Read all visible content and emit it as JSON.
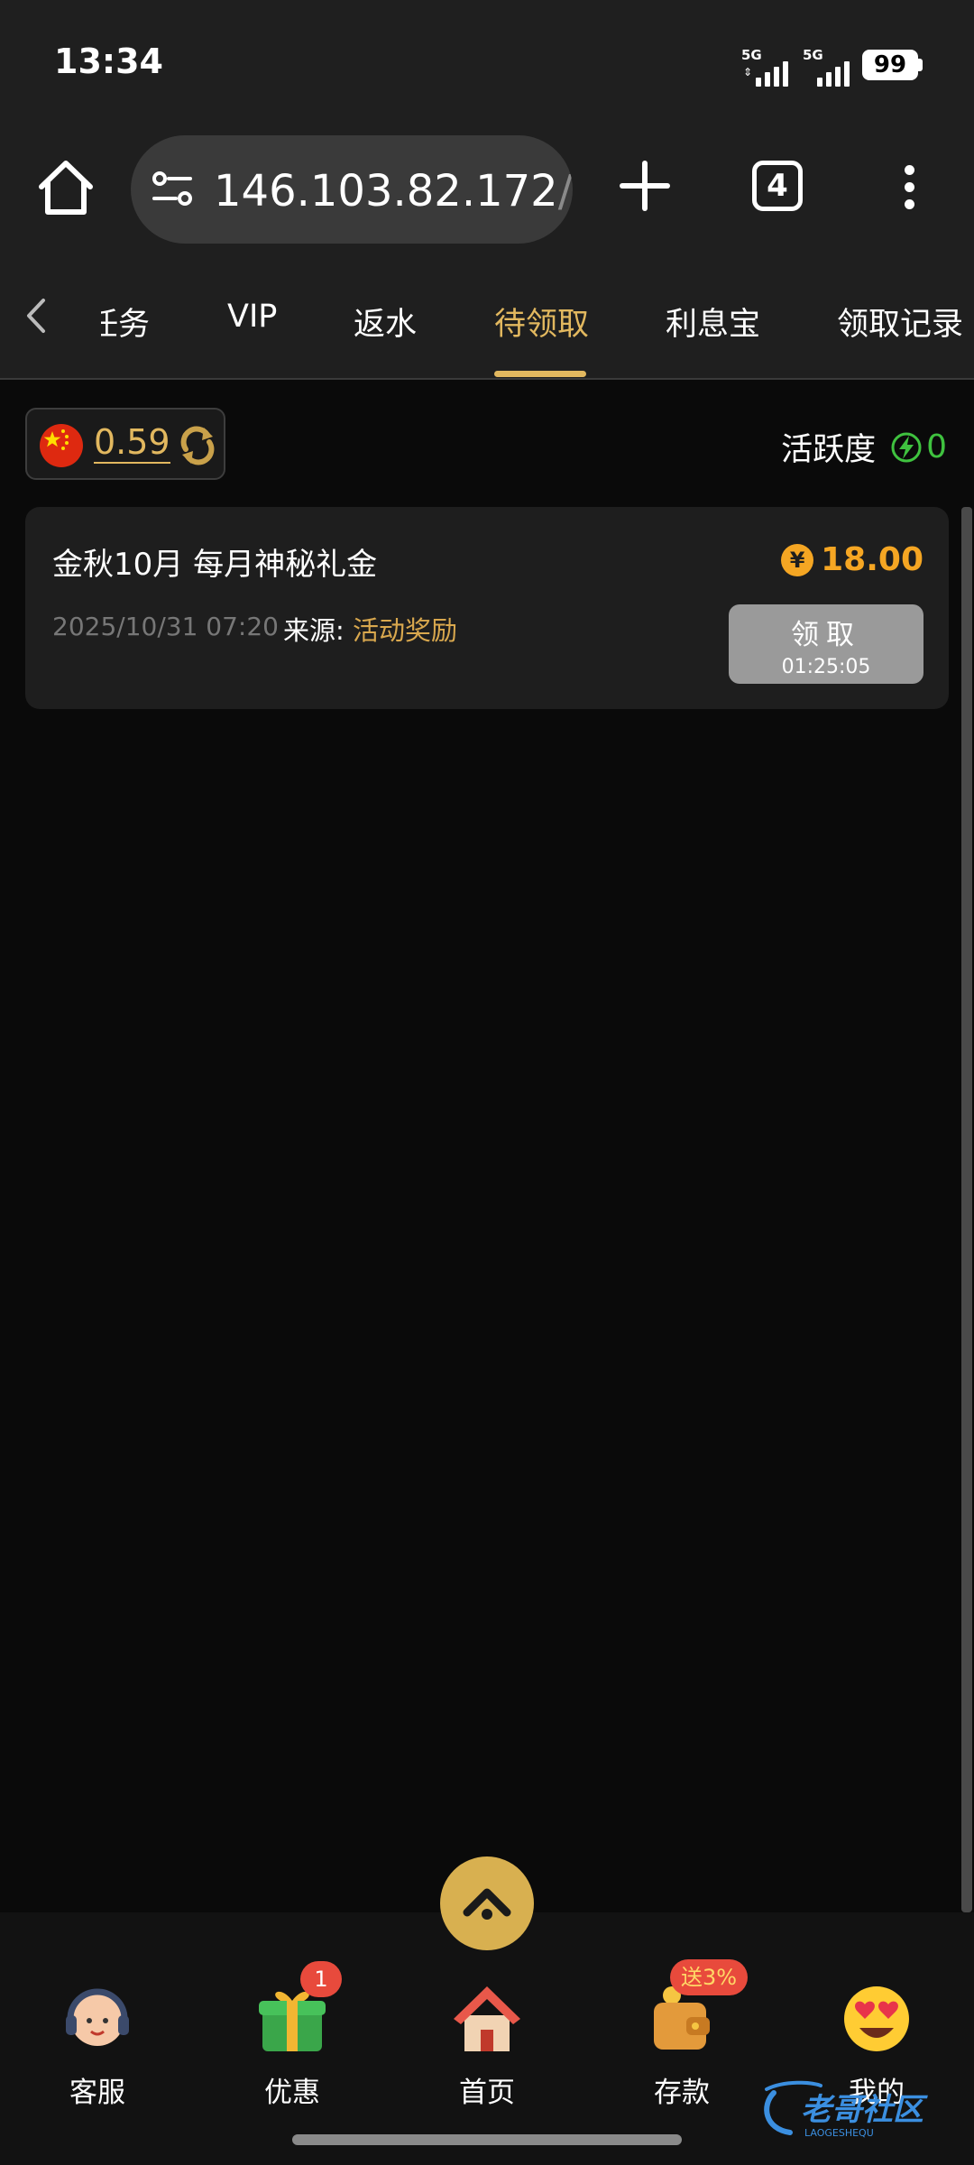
{
  "status_bar": {
    "time": "13:34",
    "signal_1_label": "5G",
    "signal_2_label": "5G",
    "battery": "99"
  },
  "browser": {
    "url_main": "146.103.82.172",
    "url_dim": "/h",
    "tab_count": "4",
    "icons": [
      "home-icon",
      "tune-icon",
      "plus-icon",
      "tabs-icon",
      "more-vert-icon"
    ]
  },
  "tabs": {
    "items": [
      {
        "label": "任务"
      },
      {
        "label": "VIP"
      },
      {
        "label": "返水"
      },
      {
        "label": "待领取"
      },
      {
        "label": "利息宝"
      },
      {
        "label": "领取记录"
      }
    ],
    "active_index": 3
  },
  "wallet": {
    "balance": "0.59",
    "activity_label": "活跃度",
    "activity_value": "0"
  },
  "rewards": [
    {
      "title": "金秋10月 每月神秘礼金",
      "currency_symbol": "¥",
      "amount": "18.00",
      "date": "2025/10/31 07:20",
      "source_label": "来源:",
      "source_value": "活动奖励",
      "claim_label": "领取",
      "countdown": "01:25:05"
    }
  ],
  "bottom_nav": {
    "items": [
      {
        "label": "客服",
        "icon": "support-agent-icon"
      },
      {
        "label": "优惠",
        "icon": "gift-icon",
        "badge": "1"
      },
      {
        "label": "首页",
        "icon": "house-icon"
      },
      {
        "label": "存款",
        "icon": "wallet-icon",
        "badge": "送3%"
      },
      {
        "label": "我的",
        "icon": "heart-eyes-emoji-icon"
      }
    ]
  },
  "colors": {
    "accent_gold": "#e2b85f",
    "amount_orange": "#f5a623",
    "activity_green": "#3fc23f",
    "badge_red": "#e84a3c"
  }
}
